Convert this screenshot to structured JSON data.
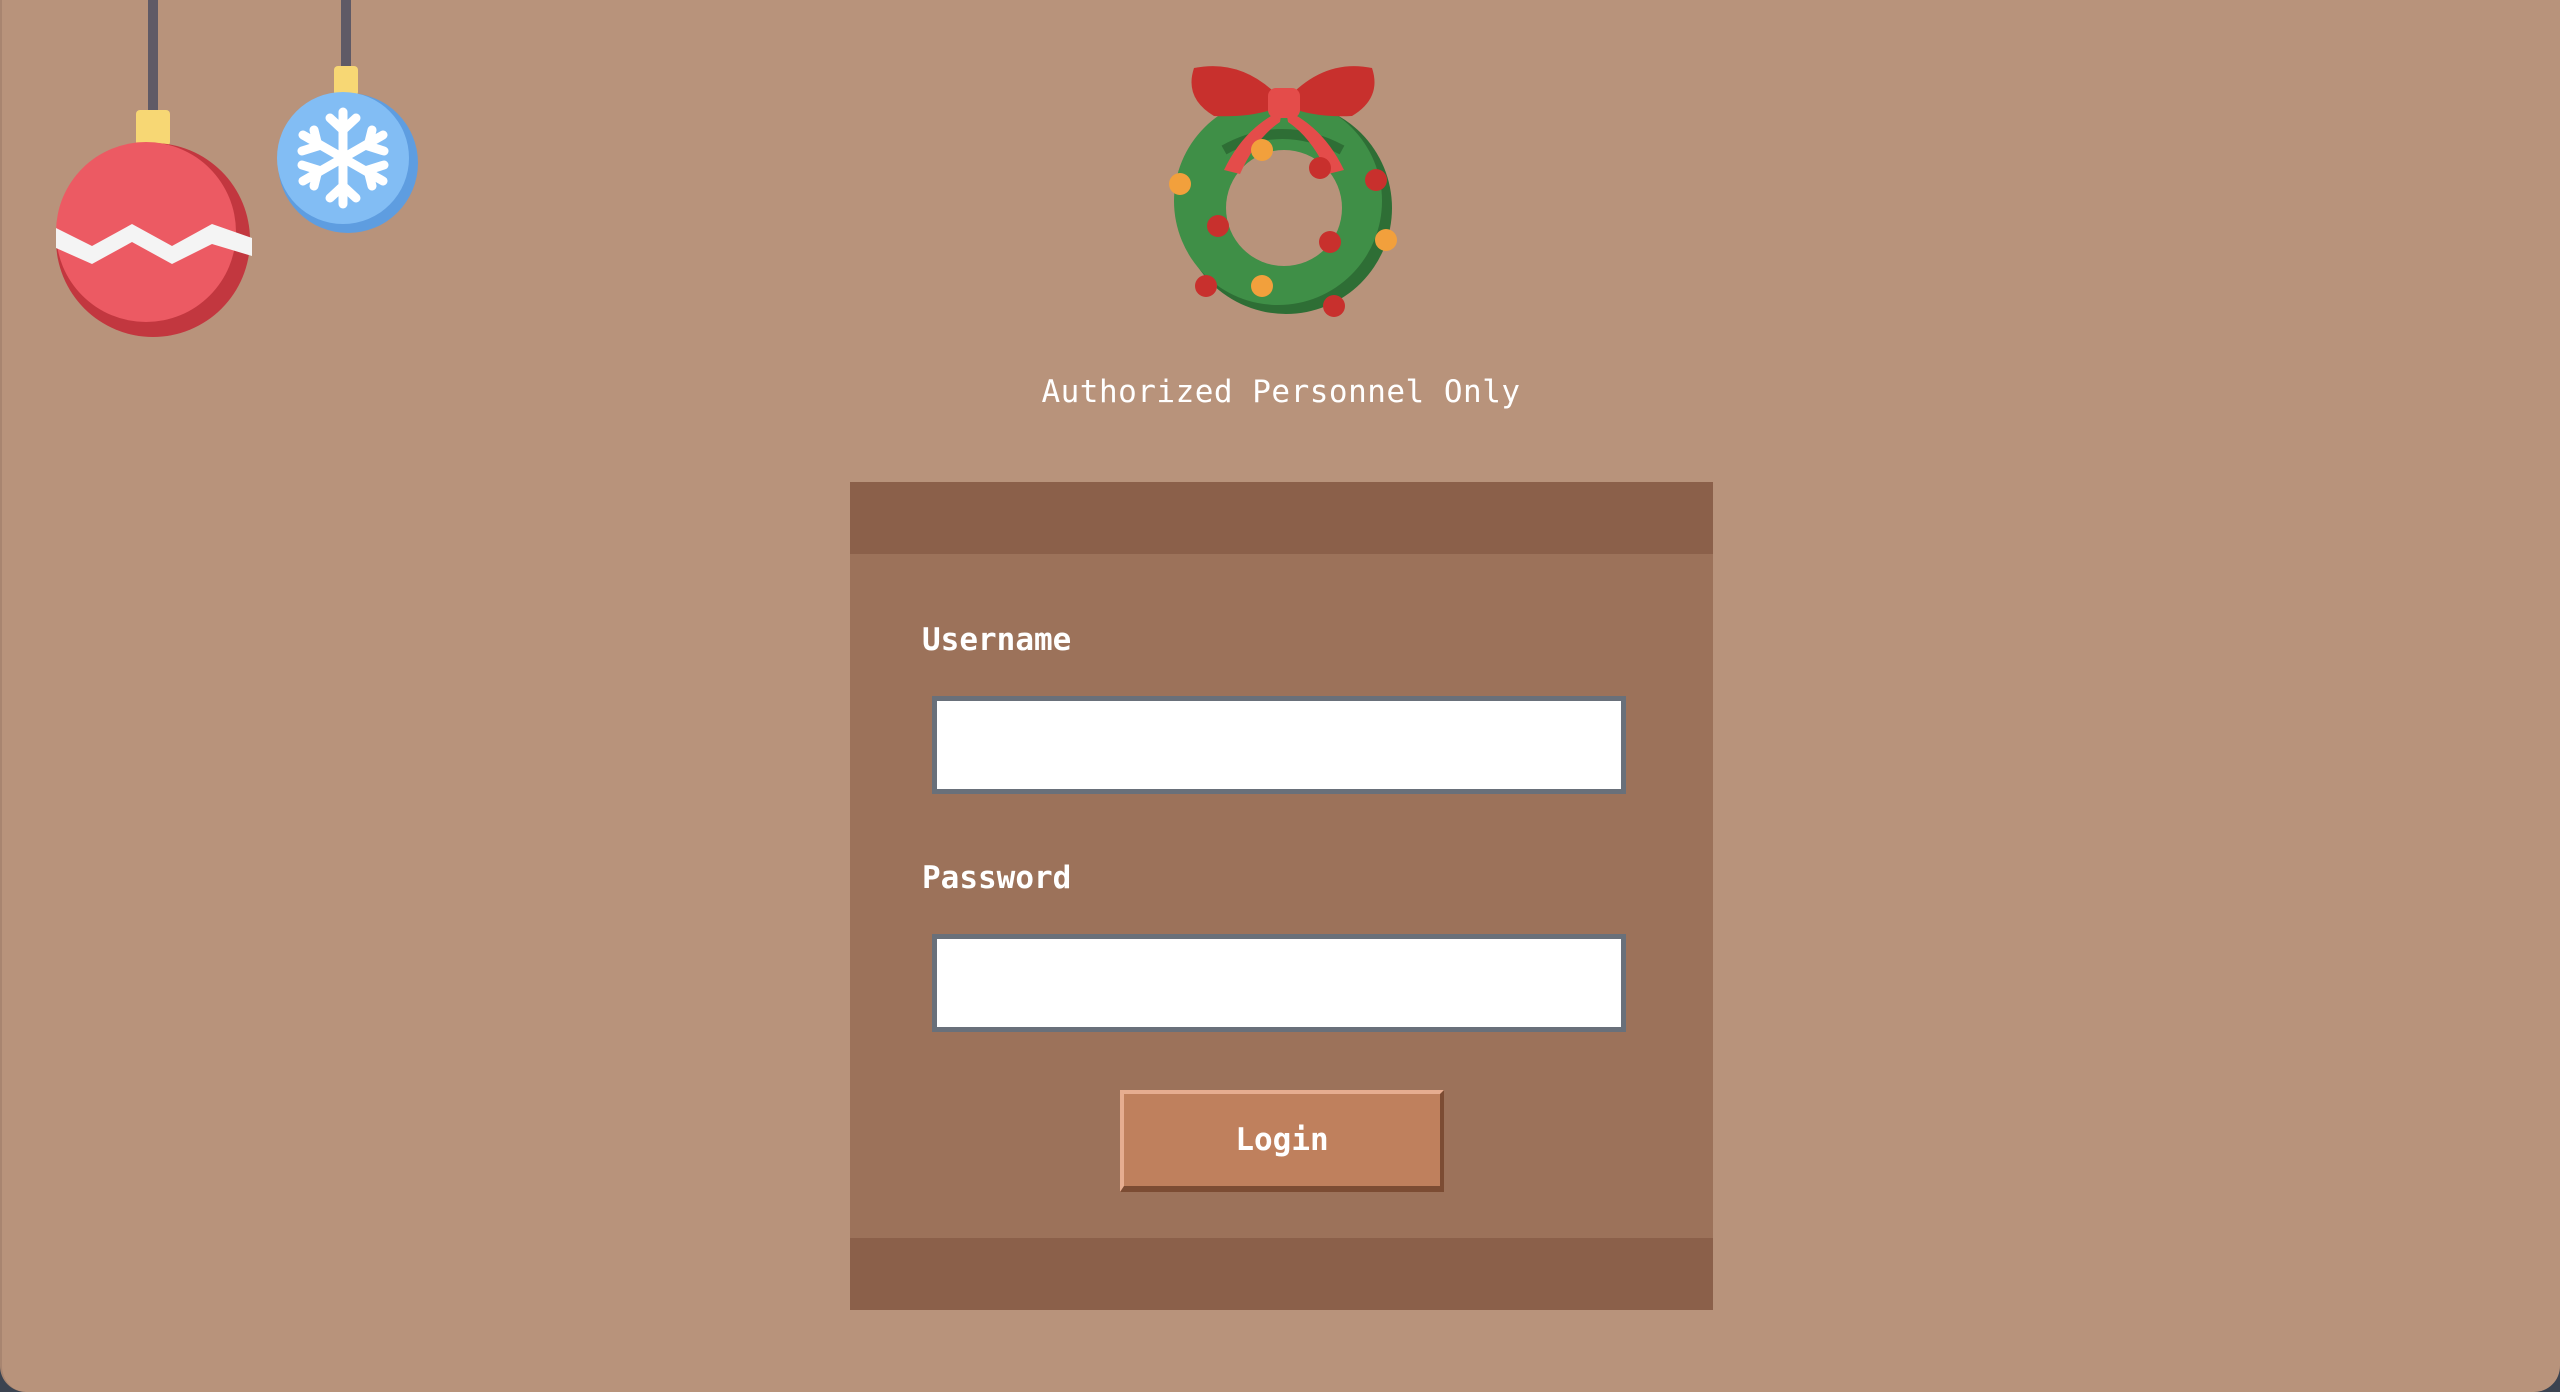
{
  "page": {
    "subtitle": "Authorized Personnel Only"
  },
  "form": {
    "username_label": "Username",
    "username_value": "",
    "password_label": "Password",
    "password_value": "",
    "login_label": "Login"
  },
  "colors": {
    "background": "#b8937b",
    "card": "#9c725a",
    "card_band": "#8b604a",
    "button": "#bf805d",
    "ornament_red": "#ec5a63",
    "ornament_blue": "#7cb8f2",
    "wreath_green": "#3e8c48"
  },
  "icons": {
    "left_ornament": "red-christmas-ornament-icon",
    "right_ornament": "blue-snowflake-ornament-icon",
    "header": "christmas-wreath-icon"
  }
}
